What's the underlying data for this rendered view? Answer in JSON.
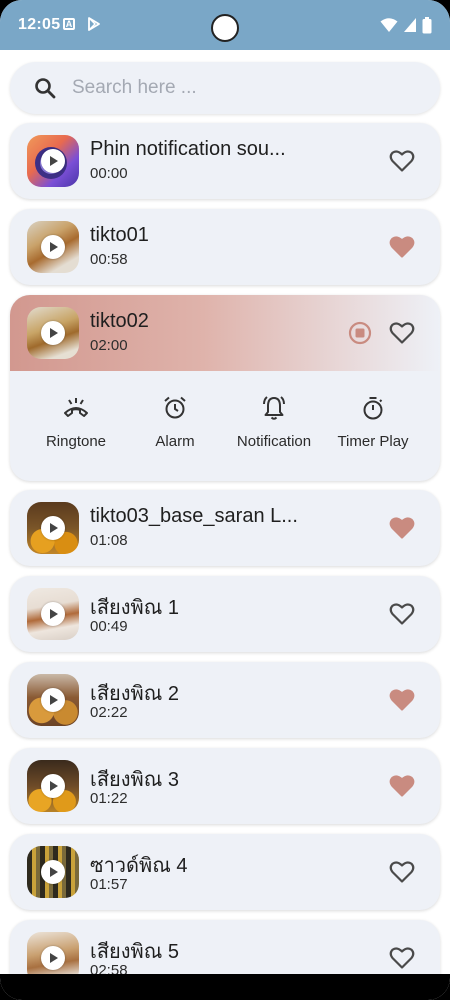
{
  "status_bar": {
    "time": "12:05"
  },
  "search": {
    "placeholder": "Search here ..."
  },
  "colors": {
    "accent": "#c98b80",
    "status_bar": "#7aa7c7",
    "card": "#eef1f7"
  },
  "items": [
    {
      "title": "Phin notification sou...",
      "duration": "00:00",
      "favorite": false
    },
    {
      "title": "tikto01",
      "duration": "00:58",
      "favorite": true
    },
    {
      "title": "tikto02",
      "duration": "02:00",
      "favorite": false,
      "playing": true
    },
    {
      "title": "tikto03_base_saran L...",
      "duration": "01:08",
      "favorite": true
    },
    {
      "title": "เสียงพิณ 1",
      "duration": "00:49",
      "favorite": false
    },
    {
      "title": "เสียงพิณ 2",
      "duration": "02:22",
      "favorite": true
    },
    {
      "title": "เสียงพิณ 3",
      "duration": "01:22",
      "favorite": true
    },
    {
      "title": "ซาวด์พิณ 4",
      "duration": "01:57",
      "favorite": false
    },
    {
      "title": "เสียงพิณ 5",
      "duration": "02:58",
      "favorite": false
    }
  ],
  "actions": [
    {
      "label": "Ringtone",
      "icon": "phone-ringtone-icon"
    },
    {
      "label": "Alarm",
      "icon": "alarm-clock-icon"
    },
    {
      "label": "Notification",
      "icon": "bell-ring-icon"
    },
    {
      "label": "Timer Play",
      "icon": "stopwatch-icon"
    }
  ]
}
